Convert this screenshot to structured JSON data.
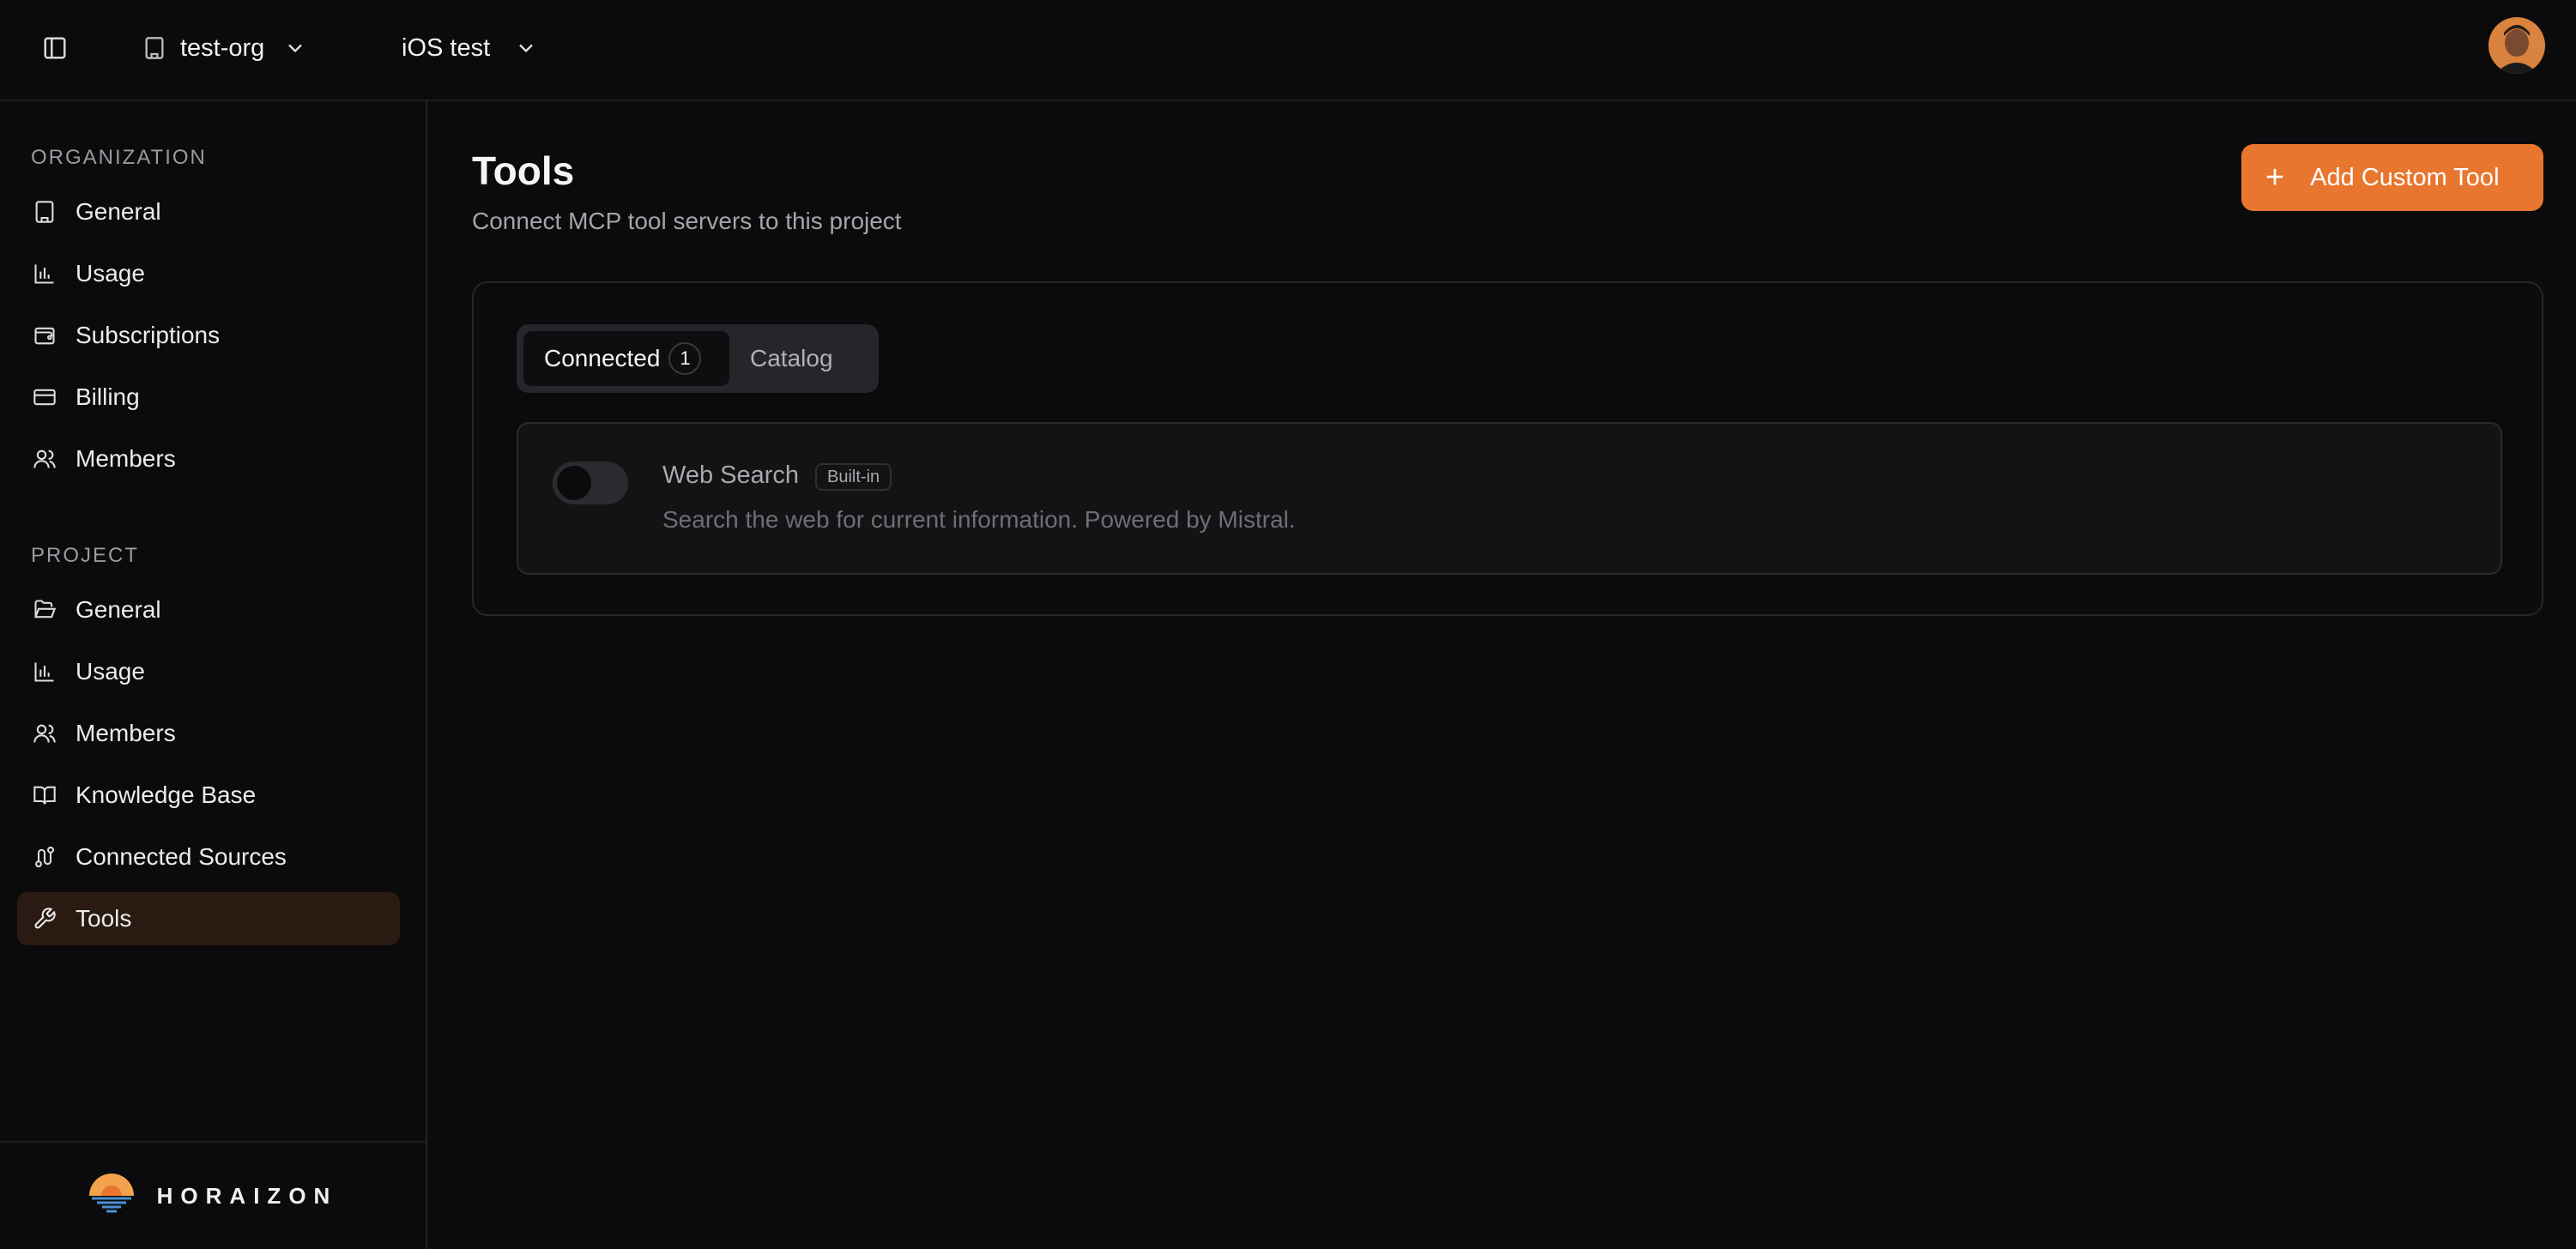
{
  "header": {
    "org_switcher": {
      "label": "test-org",
      "icon": "building-icon"
    },
    "project_switcher": {
      "label": "iOS test"
    },
    "avatar_icon": "user-avatar"
  },
  "sidebar": {
    "organization_label": "ORGANIZATION",
    "organization_items": [
      {
        "label": "General",
        "icon": "building-icon"
      },
      {
        "label": "Usage",
        "icon": "bar-chart-icon"
      },
      {
        "label": "Subscriptions",
        "icon": "wallet-icon"
      },
      {
        "label": "Billing",
        "icon": "credit-card-icon"
      },
      {
        "label": "Members",
        "icon": "users-icon"
      }
    ],
    "project_label": "PROJECT",
    "project_items": [
      {
        "label": "General",
        "icon": "folder-open-icon"
      },
      {
        "label": "Usage",
        "icon": "bar-chart-icon"
      },
      {
        "label": "Members",
        "icon": "users-icon"
      },
      {
        "label": "Knowledge Base",
        "icon": "book-open-icon"
      },
      {
        "label": "Connected Sources",
        "icon": "route-icon"
      },
      {
        "label": "Tools",
        "icon": "wrench-icon",
        "active": true
      }
    ],
    "brand": "HORAIZON"
  },
  "main": {
    "title": "Tools",
    "subtitle": "Connect MCP tool servers to this project",
    "add_button_label": "Add Custom Tool",
    "tabs": [
      {
        "label": "Connected",
        "count": "1",
        "selected": true
      },
      {
        "label": "Catalog",
        "selected": false
      }
    ],
    "tools": [
      {
        "name": "Web Search",
        "badge": "Built-in",
        "description": "Search the web for current information. Powered by Mistral.",
        "enabled": false
      }
    ]
  },
  "colors": {
    "background": "#0b0b0d",
    "accent": "#e8762f",
    "active_nav_bg": "#2a1a12"
  }
}
